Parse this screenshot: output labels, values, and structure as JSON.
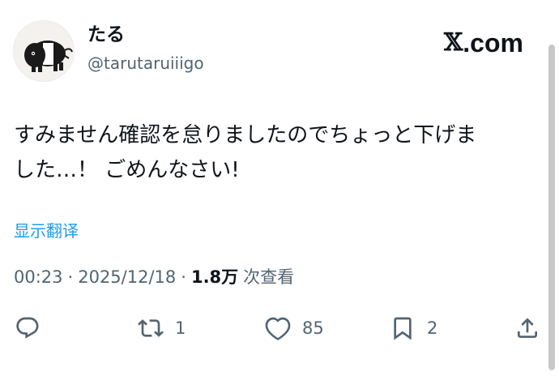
{
  "author": {
    "display_name": "たる",
    "handle": "@tarutaruiiigo"
  },
  "brand": {
    "x_glyph": "𝕏",
    "domain": ".com"
  },
  "tweet": {
    "text_lines": [
      "すみません確認を怠りましたのでちょっと下げま",
      "した…！ ごめんなさい!"
    ],
    "translate_label": "显示翻译"
  },
  "meta": {
    "time": "00:23",
    "separator": "·",
    "date": "2025/12/18",
    "views_count": "1.8万",
    "views_label": "次查看"
  },
  "actions": {
    "reply": {
      "icon": "reply-icon"
    },
    "retweet": {
      "icon": "retweet-icon",
      "count": "1"
    },
    "like": {
      "icon": "like-icon",
      "count": "85"
    },
    "bookmark": {
      "icon": "bookmark-icon",
      "count": "2"
    },
    "share": {
      "icon": "share-icon"
    }
  },
  "colors": {
    "text": "#0f1419",
    "secondary": "#536471",
    "link": "#1d9bf0"
  }
}
